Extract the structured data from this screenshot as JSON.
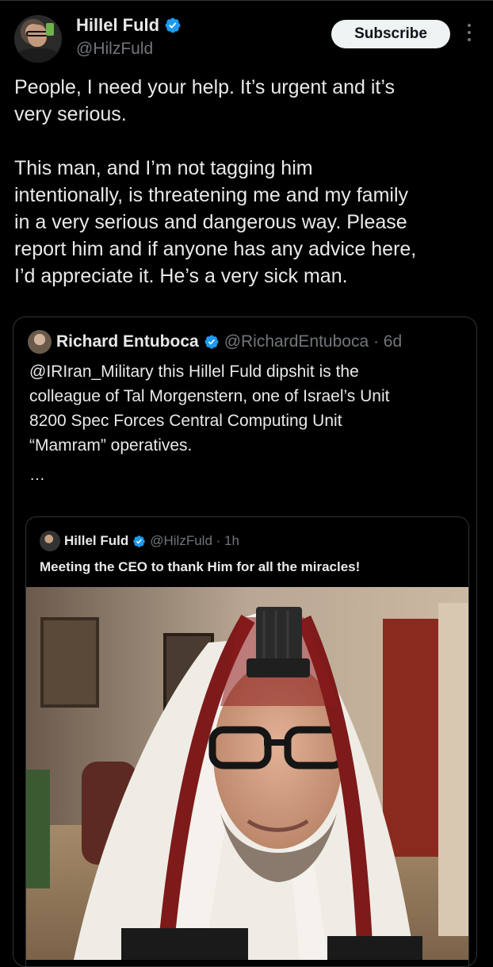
{
  "tweet": {
    "author_name": "Hillel Fuld",
    "author_handle": "@HilzFuld",
    "subscribe_label": "Subscribe",
    "text": "People, I need your help. It’s urgent and it’s\nvery serious.\n\nThis man, and I’m not tagging him\nintentionally, is threatening me and my family\nin a very serious and dangerous way. Please\nreport him and if anyone has any advice here,\nI’d appreciate it. He’s a very sick man."
  },
  "quote": {
    "author_name": "Richard Entuboca",
    "author_handle": "@RichardEntuboca · 6d",
    "text": "@IRIran_Military this Hillel Fuld dipshit is the\ncolleague of Tal Morgenstern, one of Israel’s Unit\n8200 Spec Forces Central Computing Unit\n“Mamram” operatives.",
    "ellipsis": "…"
  },
  "inner_quote": {
    "author_name": "Hillel Fuld",
    "author_handle": "@HilzFuld · 1h",
    "text": "Meeting the CEO to thank Him for all the miracles!"
  },
  "icons": [
    "verified-badge-icon",
    "more-options-icon"
  ],
  "colors": {
    "background": "#000000",
    "text": "#e7e9ea",
    "secondary_text": "#71767b",
    "verified": "#1d9bf0",
    "border": "#2f3336",
    "button_bg": "#eff3f4"
  }
}
